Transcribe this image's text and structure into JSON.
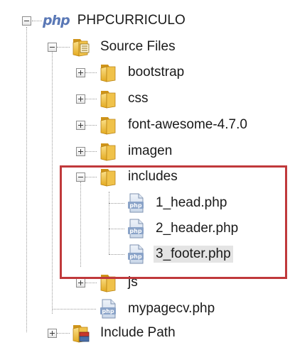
{
  "project": {
    "badge": "php",
    "name": "PHPCURRICULO"
  },
  "tree": {
    "source_files": "Source Files",
    "folders": {
      "bootstrap": "bootstrap",
      "css": "css",
      "font_awesome": "font-awesome-4.7.0",
      "imagen": "imagen",
      "includes": "includes",
      "js": "js"
    },
    "files": {
      "head": "1_head.php",
      "header": "2_header.php",
      "footer": "3_footer.php",
      "mypagecv": "mypagecv.php"
    },
    "file_icon_text": "php",
    "include_path": "Include Path"
  },
  "colors": {
    "folder": "#e8b52c",
    "highlight": "#c0393b",
    "selection": "#e4e4e4"
  }
}
